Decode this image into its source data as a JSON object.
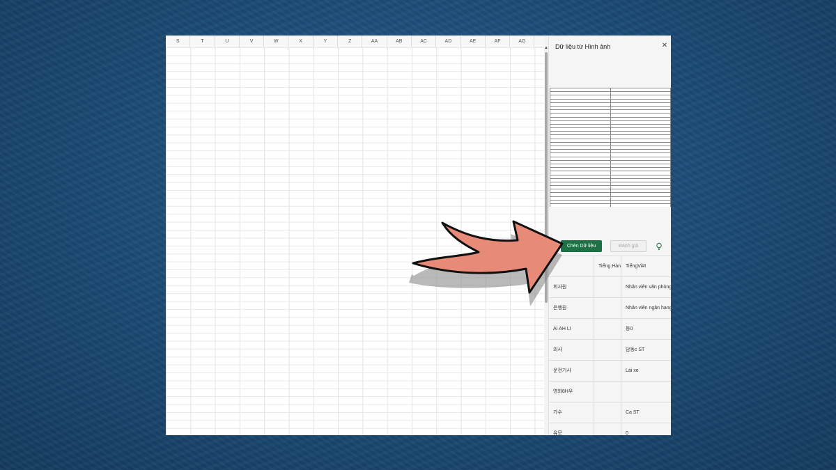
{
  "spreadsheet": {
    "columns": [
      "S",
      "T",
      "U",
      "V",
      "W",
      "X",
      "Y",
      "Z",
      "AA",
      "AB",
      "AC",
      "AD",
      "AE",
      "AF",
      "AG"
    ]
  },
  "pane": {
    "title": "Dữ liệu từ Hình ảnh",
    "close_icon": "close-icon",
    "insert_label": "Chèn Dữ liệu",
    "review_label": "Đánh giá",
    "hint_icon": "lightbulb-icon",
    "results": {
      "headers": [
        "",
        "Tiếng Hàn",
        "TiếngVi#t"
      ],
      "rows": [
        [
          "회사원",
          "",
          "Nhân viên văn phòng"
        ],
        [
          "은행원",
          "",
          "Nhân viên ngân hang"
        ],
        [
          "AI AH LI",
          "",
          "등0"
        ],
        [
          "의사",
          "",
          "담동c ST"
        ],
        [
          "운전기사",
          "",
          "Lái xe"
        ],
        [
          "영화8H우",
          "",
          ""
        ],
        [
          "가수",
          "",
          "Ca ST"
        ],
        [
          "유모",
          "",
          "0"
        ]
      ]
    }
  },
  "colors": {
    "background": "#1d4d78",
    "insert_button": "#1e7145",
    "arrow_fill": "#e88a78"
  }
}
